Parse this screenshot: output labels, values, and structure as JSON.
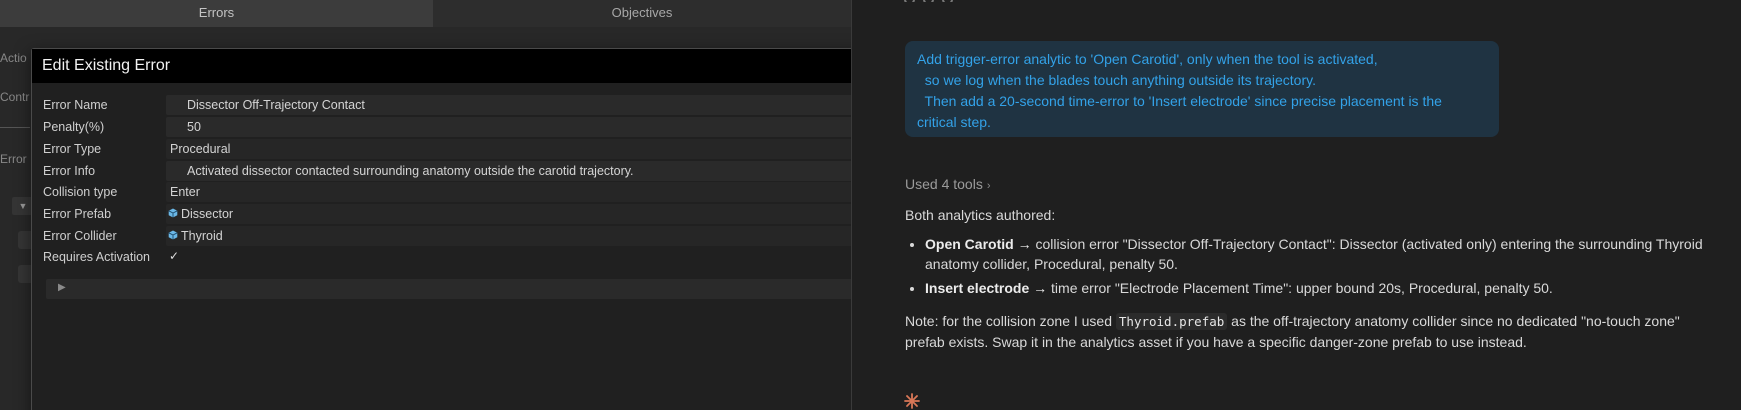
{
  "editor": {
    "tabs": [
      {
        "label": "Errors"
      },
      {
        "label": "Objectives"
      }
    ],
    "background_labels": [
      "Actio",
      "Contr",
      "Error"
    ]
  },
  "dialog": {
    "title": "Edit Existing Error",
    "fields": [
      {
        "label": "Error Name",
        "value": "Dissector Off-Trajectory Contact"
      },
      {
        "label": "Penalty(%)",
        "value": "50"
      },
      {
        "label": "Error Type",
        "value": "Procedural"
      },
      {
        "label": "Error Info",
        "value": "Activated dissector contacted surrounding anatomy outside the carotid trajectory."
      },
      {
        "label": "Collision type",
        "value": "Enter"
      },
      {
        "label": "Error Prefab",
        "value": "Dissector",
        "icon": "prefab-cube-icon"
      },
      {
        "label": "Error Collider",
        "value": "Thyroid",
        "icon": "prefab-cube-icon"
      },
      {
        "label": "Requires Activation",
        "checked": true,
        "check_glyph": "✓"
      }
    ],
    "foldout_glyph": "▶"
  },
  "chat": {
    "user_message": "Add trigger-error analytic to 'Open Carotid', only when the tool is activated,\n  so we log when the blades touch anything outside its trajectory.\n  Then add a 20-second time-error to 'Insert electrode' since precise placement is the\ncritical step.",
    "used_tools": "Used 4 tools",
    "used_tools_chevron": "›",
    "summary_heading": "Both analytics authored:",
    "bullet1_bold": "Open Carotid",
    "bullet1_arrow": "→",
    "bullet1_text": " collision error \"Dissector Off-Trajectory Contact\": Dissector (activated only) entering the surrounding Thyroid anatomy collider, Procedural, penalty 50.",
    "bullet2_bold": "Insert electrode",
    "bullet2_arrow": "→",
    "bullet2_text": " time error \"Electrode Placement Time\": upper bound 20s, Procedural, penalty 50.",
    "note_before": "Note: for the collision zone I used ",
    "note_code": "Thyroid.prefab",
    "note_after": " as the off-trajectory anatomy collider since no dedicated \"no-touch zone\" prefab exists. Swap it in the analytics asset if you have a specific danger-zone prefab to use instead.",
    "spark_icon": "spark-icon"
  },
  "colors": {
    "user_bubble_bg": "#1f3342",
    "user_text": "#33a2e8",
    "spark": "#d97757",
    "prefab_icon": "#6ab7e6"
  }
}
